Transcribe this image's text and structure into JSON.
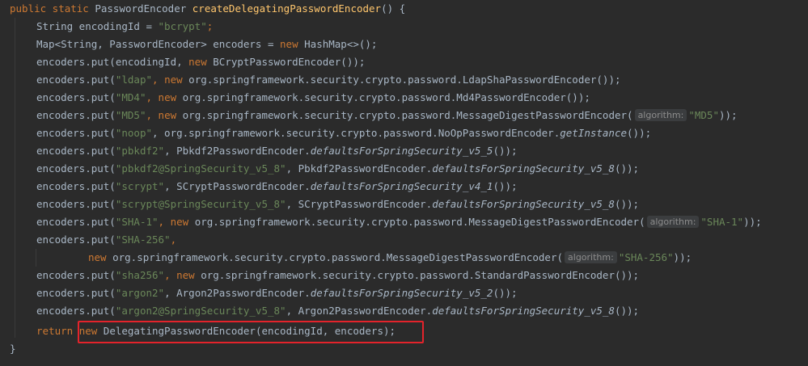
{
  "code": {
    "l0": {
      "a": "public static ",
      "b": "PasswordEncoder ",
      "c": "createDelegatingPasswordEncoder",
      "d": "() {"
    },
    "l1": {
      "a": "String encodingId = ",
      "b": "\"bcrypt\"",
      "c": ";"
    },
    "l2": {
      "a": "Map<String, PasswordEncoder> encoders = ",
      "b": "new ",
      "c": "HashMap<>();"
    },
    "l3": {
      "a": "encoders.put(encodingId, ",
      "b": "new ",
      "c": "BCryptPasswordEncoder());"
    },
    "l4": {
      "a": "encoders.put(",
      "b": "\"ldap\"",
      "c": ", ",
      "d": "new ",
      "e": "org.springframework.security.crypto.password.LdapShaPasswordEncoder());"
    },
    "l5": {
      "a": "encoders.put(",
      "b": "\"MD4\"",
      "c": ", ",
      "d": "new ",
      "e": "org.springframework.security.crypto.password.Md4PasswordEncoder());"
    },
    "l6": {
      "a": "encoders.put(",
      "b": "\"MD5\"",
      "c": ", ",
      "d": "new ",
      "e": "org.springframework.security.crypto.password.MessageDigestPasswordEncoder(",
      "hint": "algorithm:",
      "f": "\"MD5\"",
      "g": "));"
    },
    "l7": {
      "a": "encoders.put(",
      "b": "\"noop\"",
      "c": ", org.springframework.security.crypto.password.NoOpPasswordEncoder.",
      "d": "getInstance",
      "e": "());"
    },
    "l8": {
      "a": "encoders.put(",
      "b": "\"pbkdf2\"",
      "c": ", Pbkdf2PasswordEncoder.",
      "d": "defaultsForSpringSecurity_v5_5",
      "e": "());"
    },
    "l9": {
      "a": "encoders.put(",
      "b": "\"pbkdf2@SpringSecurity_v5_8\"",
      "c": ", Pbkdf2PasswordEncoder.",
      "d": "defaultsForSpringSecurity_v5_8",
      "e": "());"
    },
    "l10": {
      "a": "encoders.put(",
      "b": "\"scrypt\"",
      "c": ", SCryptPasswordEncoder.",
      "d": "defaultsForSpringSecurity_v4_1",
      "e": "());"
    },
    "l11": {
      "a": "encoders.put(",
      "b": "\"scrypt@SpringSecurity_v5_8\"",
      "c": ", SCryptPasswordEncoder.",
      "d": "defaultsForSpringSecurity_v5_8",
      "e": "());"
    },
    "l12": {
      "a": "encoders.put(",
      "b": "\"SHA-1\"",
      "c": ", ",
      "d": "new ",
      "e": "org.springframework.security.crypto.password.MessageDigestPasswordEncoder(",
      "hint": "algorithm:",
      "f": "\"SHA-1\"",
      "g": "));"
    },
    "l13": {
      "a": "encoders.put(",
      "b": "\"SHA-256\"",
      "c": ","
    },
    "l14": {
      "a": "new ",
      "b": "org.springframework.security.crypto.password.MessageDigestPasswordEncoder(",
      "hint": "algorithm:",
      "c": "\"SHA-256\"",
      "d": "));"
    },
    "l15": {
      "a": "encoders.put(",
      "b": "\"sha256\"",
      "c": ", ",
      "d": "new ",
      "e": "org.springframework.security.crypto.password.StandardPasswordEncoder());"
    },
    "l16": {
      "a": "encoders.put(",
      "b": "\"argon2\"",
      "c": ", Argon2PasswordEncoder.",
      "d": "defaultsForSpringSecurity_v5_2",
      "e": "());"
    },
    "l17": {
      "a": "encoders.put(",
      "b": "\"argon2@SpringSecurity_v5_8\"",
      "c": ", Argon2PasswordEncoder.",
      "d": "defaultsForSpringSecurity_v5_8",
      "e": "());"
    },
    "l18": {
      "a": "return ",
      "b": "new ",
      "c": "DelegatingPasswordEncoder(encodingId, encoders);"
    },
    "l19": {
      "a": "}"
    }
  },
  "colors": {
    "background": "#2b2b2b",
    "keyword": "#cc7832",
    "method_decl": "#ffc66d",
    "string": "#6a8759",
    "text": "#a9b7c6",
    "highlight_box": "#e3232b"
  }
}
